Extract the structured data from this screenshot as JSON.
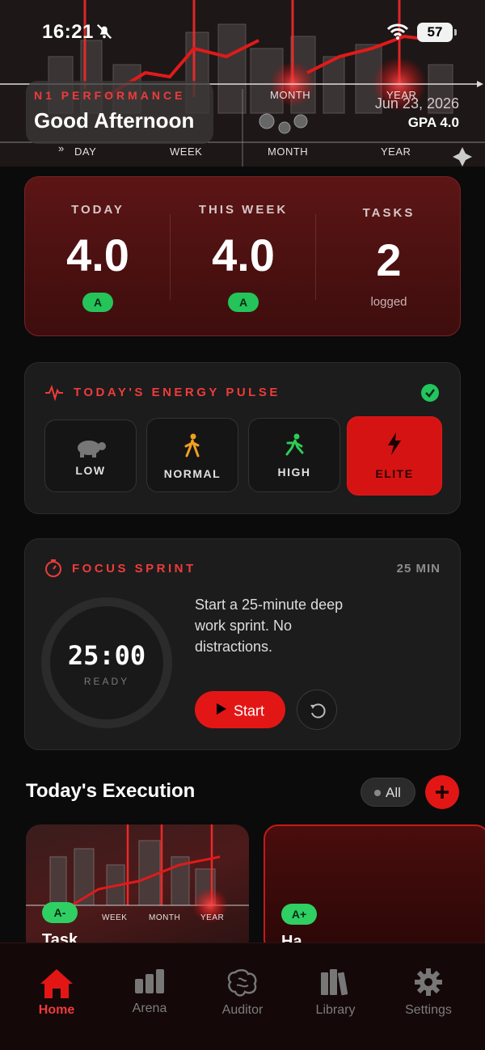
{
  "status_bar": {
    "time": "16:21",
    "battery": "57"
  },
  "hero": {
    "brand": "N1 PERFORMANCE",
    "greeting": "Good Afternoon",
    "date": "Jun 23, 2026",
    "gpa": "GPA 4.0",
    "art_labels": {
      "day": "DAY",
      "week": "WEEK",
      "month": "MONTH",
      "month_top": "MONTH",
      "year": "YEAR",
      "year_top": "YEAR"
    }
  },
  "stats": {
    "today": {
      "title": "TODAY",
      "value": "4.0",
      "grade": "A"
    },
    "week": {
      "title": "THIS WEEK",
      "value": "4.0",
      "grade": "A"
    },
    "tasks": {
      "title": "TASKS",
      "value": "2",
      "sub": "logged"
    }
  },
  "energy": {
    "title": "TODAY'S ENERGY PULSE",
    "options": [
      {
        "label": "LOW",
        "icon": "turtle-icon"
      },
      {
        "label": "NORMAL",
        "icon": "walking-icon"
      },
      {
        "label": "HIGH",
        "icon": "running-icon"
      },
      {
        "label": "ELITE",
        "icon": "lightning-icon",
        "selected": true
      }
    ]
  },
  "focus": {
    "title": "FOCUS SPRINT",
    "duration": "25 MIN",
    "timer": "25:00",
    "state": "READY",
    "description": "Start a 25-minute deep work sprint. No distractions.",
    "start_label": "Start"
  },
  "execution": {
    "title": "Today's Execution",
    "filter": "All",
    "tasks": [
      {
        "grade": "A-",
        "name": "Task",
        "labels": {
          "week": "WEEK",
          "month": "MONTH",
          "year": "YEAR"
        }
      },
      {
        "grade": "A+",
        "name": "Ha"
      }
    ]
  },
  "tabs": [
    {
      "label": "Home",
      "icon": "home-icon",
      "active": true
    },
    {
      "label": "Arena",
      "icon": "bar-chart-icon"
    },
    {
      "label": "Auditor",
      "icon": "brain-icon"
    },
    {
      "label": "Library",
      "icon": "books-icon"
    },
    {
      "label": "Settings",
      "icon": "gear-icon"
    }
  ],
  "colors": {
    "accent": "#e31616",
    "grade_green": "#24c45a",
    "background": "#0b0b0b"
  }
}
